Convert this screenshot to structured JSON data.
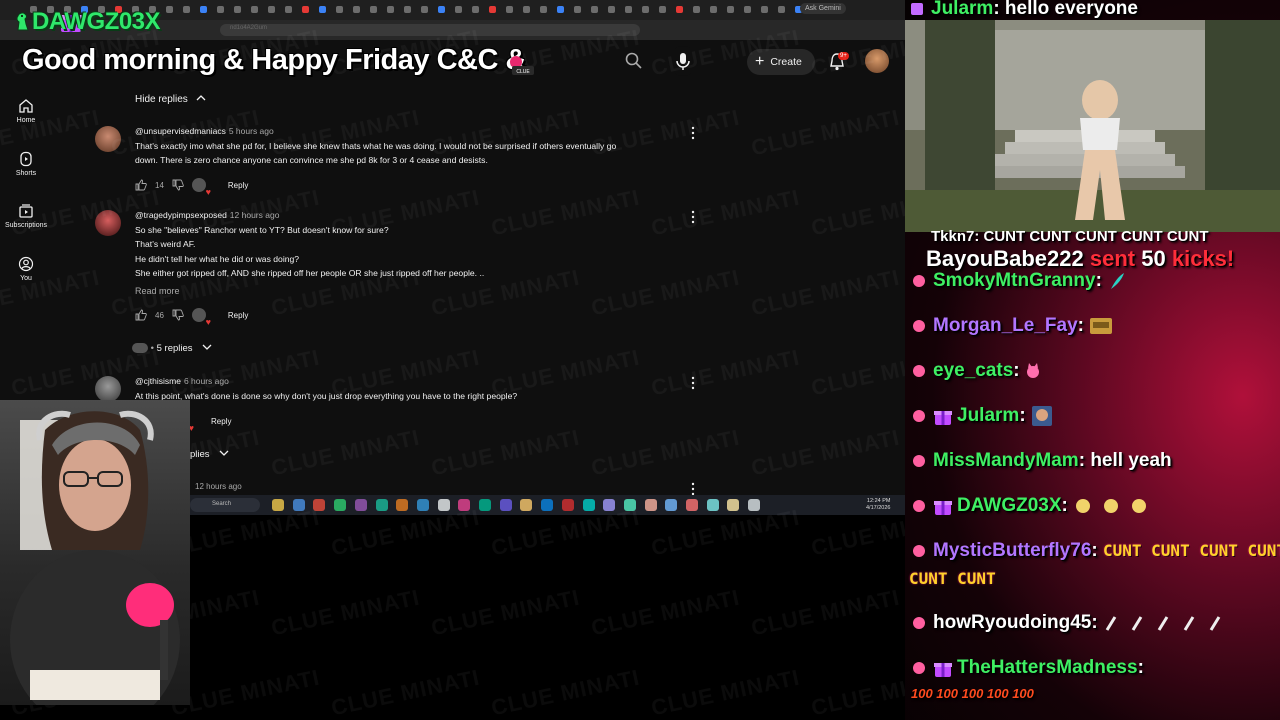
{
  "overlay": {
    "streamer_name": "DAWGZ03X",
    "title": "Good morning & Happy Friday C&C &",
    "watermark": "CLUE MINATI"
  },
  "browser": {
    "ask_gemini": "Ask Gemini",
    "url_fragment": "nd1o4A2Gum"
  },
  "youtube": {
    "create_label": "Create",
    "notification_count": "9+",
    "sidebar": [
      {
        "label": "Home"
      },
      {
        "label": "Shorts"
      },
      {
        "label": "Subscriptions"
      },
      {
        "label": "You"
      }
    ],
    "hide_replies": "Hide replies",
    "comments": [
      {
        "author": "@unsupervisedmaniacs",
        "age": "5 hours ago",
        "lines": [
          "That's exactly imo what she pd for, I believe she knew thats what he was doing.  I would not be surprised if others eventually go",
          "down. There is zero chance anyone can convince me she pd 8k for 3 or 4 cease and desists."
        ],
        "likes": "14",
        "reply": "Reply"
      },
      {
        "author": "@tragedypimpsexposed",
        "age": "12 hours ago",
        "lines": [
          "So she \"believes\" Ranchor went to YT? But doesn't know for sure?",
          "That's weird AF.",
          "He didn't tell her what he  did or was doing?",
          "She either got ripped off, AND she ripped off her people OR she just ripped off her people. .."
        ],
        "read_more": "Read more",
        "likes": "46",
        "reply": "Reply",
        "replies_toggle": "5 replies"
      },
      {
        "author": "@cjthisisme",
        "age": "6 hours ago",
        "lines": [
          "At this point, what's done is done so why don't you just drop everything you have to the right people?"
        ],
        "reply": "Reply",
        "replies_toggle": "plies"
      },
      {
        "age": "12 hours ago"
      }
    ]
  },
  "taskbar": {
    "search_label": "Search",
    "time": "12:24 PM",
    "date": "4/17/2026"
  },
  "chat": {
    "top_line": {
      "user": "Jularm",
      "text": "hello everyone"
    },
    "partial_line": "Tkkn7: CUNT CUNT CUNT CUNT CUNT",
    "kick_alert": {
      "user": "BayouBabe222",
      "action": "sent",
      "amount": "50",
      "unit": "kicks!"
    },
    "messages": [
      {
        "user": "SmokyMtnGranny",
        "text": ""
      },
      {
        "user": "Morgan_Le_Fay",
        "text": ""
      },
      {
        "user": "eye_cats",
        "text": ""
      },
      {
        "user": "Jularm",
        "text": ""
      },
      {
        "user": "MissMandyMam",
        "text": "hell yeah"
      },
      {
        "user": "DAWGZ03X",
        "text": ""
      },
      {
        "user": "MysticButterfly76",
        "text": "CUNT CUNT CUNT CUNT CUNT",
        "text_wrap": "CUNT CUNT"
      },
      {
        "user": "howRyoudoing45",
        "text": ""
      },
      {
        "user": "TheHattersMadness",
        "text": "",
        "emotes": "100 100 100 100 100"
      }
    ]
  },
  "colors": {
    "green": "#3fef63",
    "purple": "#b276ff",
    "kick_red": "#ff2e3a",
    "youtube_bg": "#0f0f0f"
  }
}
